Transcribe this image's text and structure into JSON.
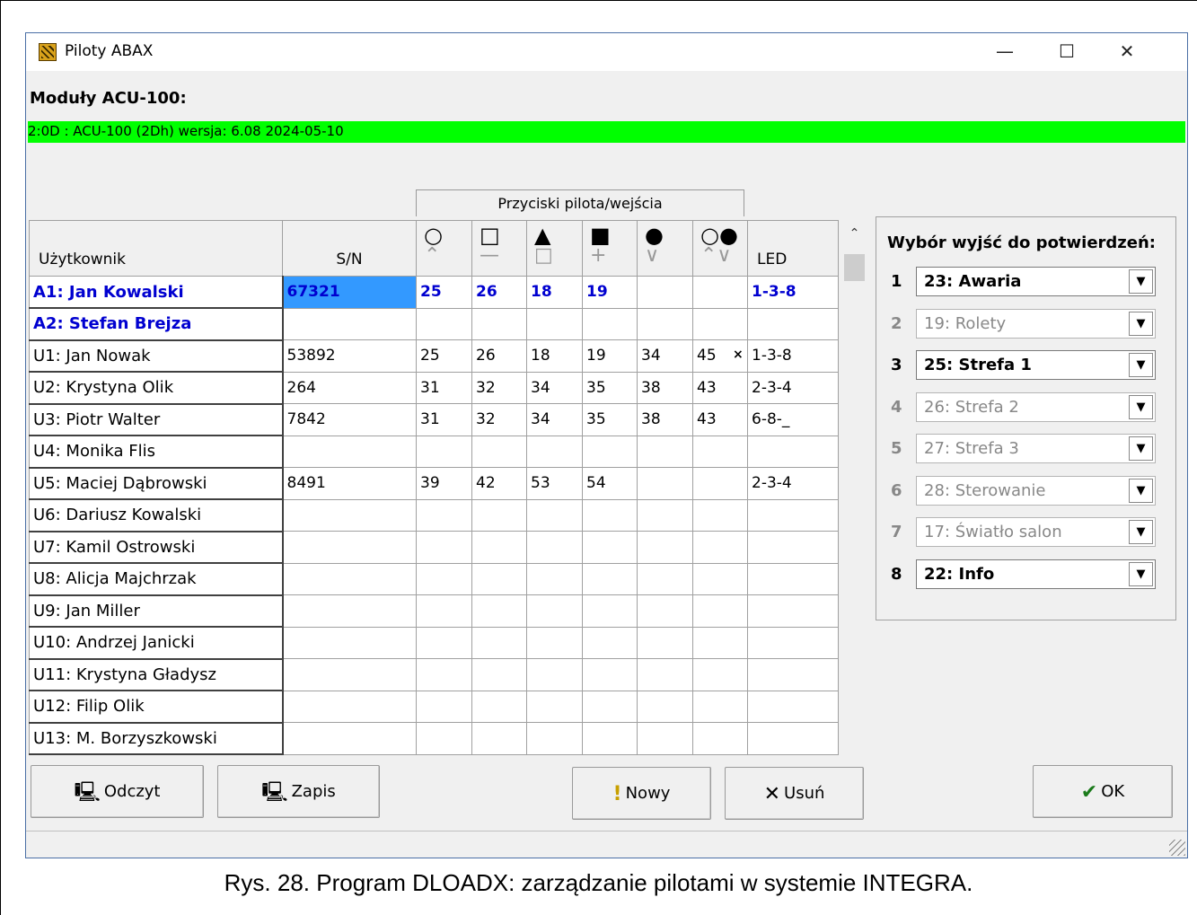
{
  "window": {
    "title": "Piloty ABAX"
  },
  "modules": {
    "label": "Moduły ACU-100:",
    "entries": [
      "2:0D :  ACU-100   (2Dh) wersja: 6.08 2024-05-10"
    ]
  },
  "grid": {
    "group_header": "Przyciski pilota/wejścia",
    "columns": {
      "user": "Użytkownik",
      "sn": "S/N",
      "led": "LED"
    },
    "button_symbols": [
      {
        "top": "○",
        "bottom": "⌃"
      },
      {
        "top": "□",
        "bottom": "—"
      },
      {
        "top": "▲",
        "bottom": "□"
      },
      {
        "top": "■",
        "bottom": "+"
      },
      {
        "top": "●",
        "bottom": "∨"
      },
      {
        "top": "○●",
        "bottom": "⌃∨"
      }
    ],
    "rows": [
      {
        "user": "A1: Jan Kowalski",
        "sn": "67321",
        "b1": "25",
        "b2": "26",
        "b3": "18",
        "b4": "19",
        "b5": "",
        "b6": "",
        "led": "1-3-8"
      },
      {
        "user": "A2: Stefan Brejza",
        "sn": "",
        "b1": "",
        "b2": "",
        "b3": "",
        "b4": "",
        "b5": "",
        "b6": "",
        "led": ""
      },
      {
        "user": "U1: Jan Nowak",
        "sn": "53892",
        "b1": "25",
        "b2": "26",
        "b3": "18",
        "b4": "19",
        "b5": "34",
        "b6": "45",
        "led": "1-3-8"
      },
      {
        "user": "U2: Krystyna Olik",
        "sn": "264",
        "b1": "31",
        "b2": "32",
        "b3": "34",
        "b4": "35",
        "b5": "38",
        "b6": "43",
        "led": "2-3-4"
      },
      {
        "user": "U3: Piotr Walter",
        "sn": "7842",
        "b1": "31",
        "b2": "32",
        "b3": "34",
        "b4": "35",
        "b5": "38",
        "b6": "43",
        "led": "6-8-_"
      },
      {
        "user": "U4: Monika Flis",
        "sn": "",
        "b1": "",
        "b2": "",
        "b3": "",
        "b4": "",
        "b5": "",
        "b6": "",
        "led": ""
      },
      {
        "user": "U5: Maciej Dąbrowski",
        "sn": "8491",
        "b1": "39",
        "b2": "42",
        "b3": "53",
        "b4": "54",
        "b5": "",
        "b6": "",
        "led": "2-3-4"
      },
      {
        "user": "U6: Dariusz Kowalski",
        "sn": "",
        "b1": "",
        "b2": "",
        "b3": "",
        "b4": "",
        "b5": "",
        "b6": "",
        "led": ""
      },
      {
        "user": "U7: Kamil Ostrowski",
        "sn": "",
        "b1": "",
        "b2": "",
        "b3": "",
        "b4": "",
        "b5": "",
        "b6": "",
        "led": ""
      },
      {
        "user": "U8: Alicja Majchrzak",
        "sn": "",
        "b1": "",
        "b2": "",
        "b3": "",
        "b4": "",
        "b5": "",
        "b6": "",
        "led": ""
      },
      {
        "user": "U9: Jan Miller",
        "sn": "",
        "b1": "",
        "b2": "",
        "b3": "",
        "b4": "",
        "b5": "",
        "b6": "",
        "led": ""
      },
      {
        "user": "U10: Andrzej Janicki",
        "sn": "",
        "b1": "",
        "b2": "",
        "b3": "",
        "b4": "",
        "b5": "",
        "b6": "",
        "led": ""
      },
      {
        "user": "U11: Krystyna Gładysz",
        "sn": "",
        "b1": "",
        "b2": "",
        "b3": "",
        "b4": "",
        "b5": "",
        "b6": "",
        "led": ""
      },
      {
        "user": "U12: Filip Olik",
        "sn": "",
        "b1": "",
        "b2": "",
        "b3": "",
        "b4": "",
        "b5": "",
        "b6": "",
        "led": ""
      },
      {
        "user": "U13: M. Borzyszkowski",
        "sn": "",
        "b1": "",
        "b2": "",
        "b3": "",
        "b4": "",
        "b5": "",
        "b6": "",
        "led": ""
      }
    ],
    "admin_rows": 2,
    "selected": {
      "row": 0,
      "col": "sn"
    },
    "marker_row": 2,
    "marker_symbol": "×"
  },
  "outputs": {
    "title": "Wybór wyjść do potwierdzeń:",
    "items": [
      {
        "num": "1",
        "value": "23: Awaria",
        "enabled": true
      },
      {
        "num": "2",
        "value": "19: Rolety",
        "enabled": false
      },
      {
        "num": "3",
        "value": "25: Strefa 1",
        "enabled": true
      },
      {
        "num": "4",
        "value": "26: Strefa 2",
        "enabled": false
      },
      {
        "num": "5",
        "value": "27: Strefa 3",
        "enabled": false
      },
      {
        "num": "6",
        "value": "28: Sterowanie",
        "enabled": false
      },
      {
        "num": "7",
        "value": "17: Światło salon",
        "enabled": false
      },
      {
        "num": "8",
        "value": "22: Info",
        "enabled": true
      }
    ]
  },
  "buttons": {
    "read": "Odczyt",
    "write": "Zapis",
    "new": "Nowy",
    "delete": "Usuń",
    "ok": "OK"
  },
  "caption": "Rys. 28. Program DLOADX: zarządzanie pilotami w systemie INTEGRA."
}
